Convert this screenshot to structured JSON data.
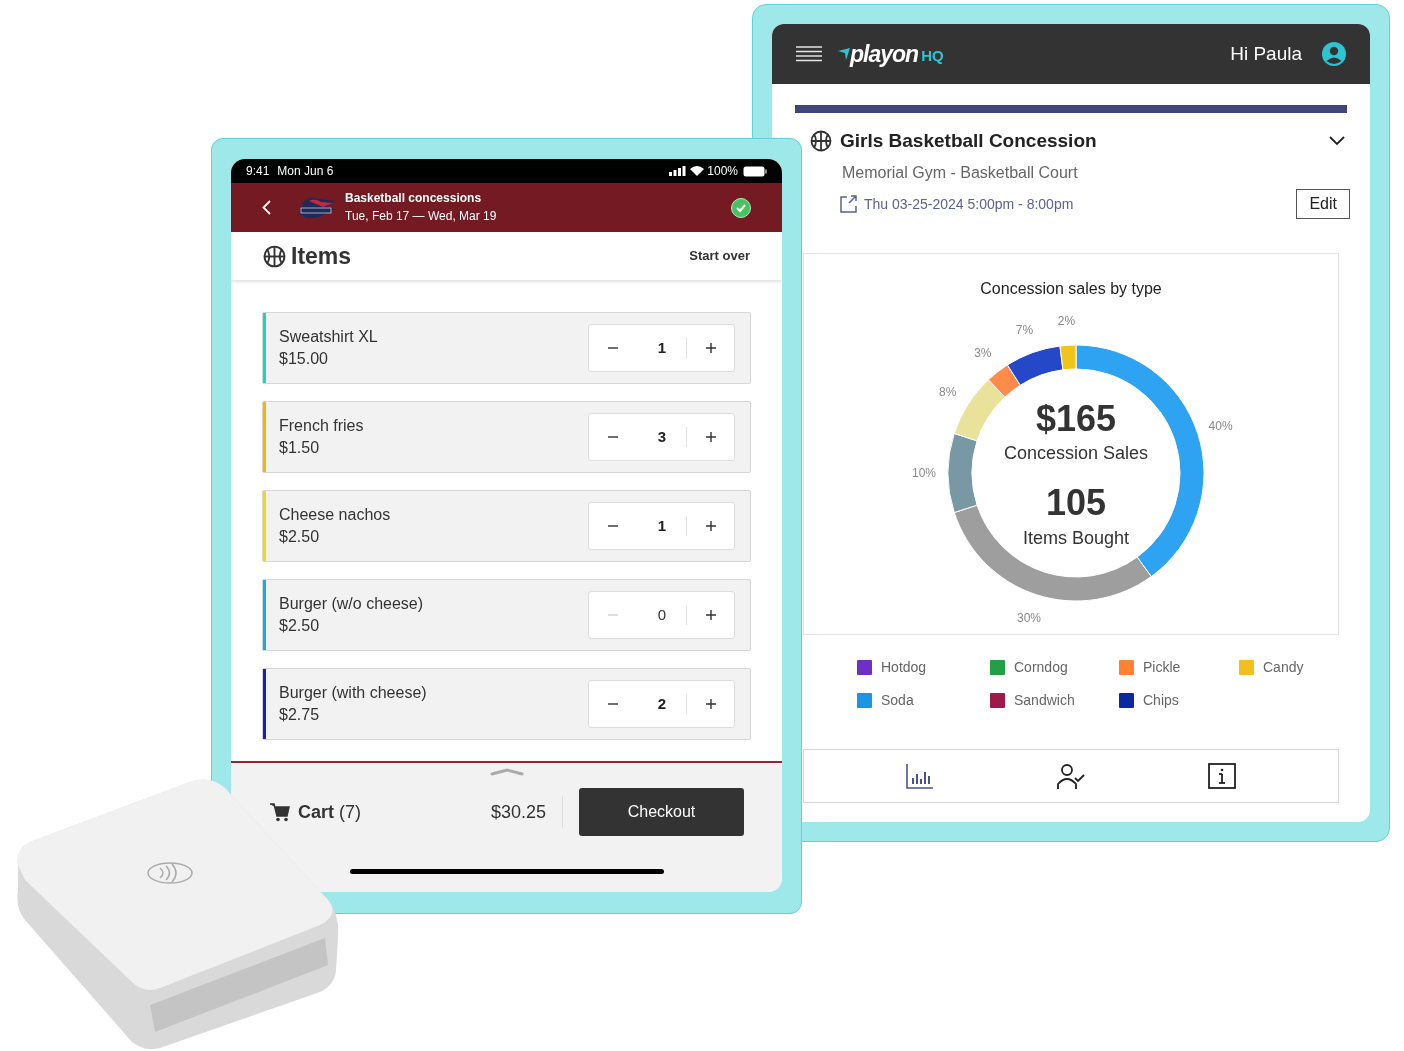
{
  "tablet": {
    "status_bar": {
      "time": "9:41",
      "date": "Mon Jun 6",
      "battery": "100%"
    },
    "header": {
      "title": "Basketball concessions",
      "dates": "Tue, Feb 17 — Wed, Mar 19"
    },
    "page_title": "Items",
    "start_over": "Start over",
    "items": [
      {
        "name": "Sweatshirt XL",
        "price": "$15.00",
        "quantity": "1",
        "color": "#1ed3c0",
        "minus_disabled": false
      },
      {
        "name": "French fries",
        "price": "$1.50",
        "quantity": "3",
        "color": "#f7b500",
        "minus_disabled": false
      },
      {
        "name": "Cheese nachos",
        "price": "$2.50",
        "quantity": "1",
        "color": "#f5d90a",
        "minus_disabled": false
      },
      {
        "name": "Burger (w/o cheese)",
        "price": "$2.50",
        "quantity": "0",
        "color": "#1ea7e8",
        "minus_disabled": true
      },
      {
        "name": "Burger (with cheese)",
        "price": "$2.75",
        "quantity": "2",
        "color": "#1a1fb8",
        "minus_disabled": false
      }
    ],
    "cart": {
      "label": "Cart",
      "count": "(7)",
      "total": "$30.25",
      "checkout": "Checkout"
    }
  },
  "dashboard": {
    "brand": "playon",
    "brand_suffix": "HQ",
    "greeting": "Hi Paula",
    "event": {
      "title": "Girls Basketball Concession",
      "location": "Memorial Gym - Basketball Court",
      "datetime": "Thu 03-25-2024 5:00pm - 8:00pm",
      "edit": "Edit"
    },
    "chart_title": "Concession sales by type",
    "chart_data": {
      "type": "donut",
      "values": [
        40,
        30,
        10,
        8,
        3,
        7,
        2
      ],
      "colors": [
        "#2ea3f2",
        "#9e9e9e",
        "#7898a3",
        "#e8e29a",
        "#ff8a4a",
        "#2448c8",
        "#f0c419"
      ],
      "data_labels": true,
      "value_labels": [
        "40%",
        "30%",
        "10%",
        "8%",
        "3%",
        "7%",
        "2%"
      ]
    },
    "center": {
      "amount": "$165",
      "amount_label": "Concession Sales",
      "count": "105",
      "count_label": "Items Bought"
    },
    "legend": [
      {
        "label": "Hotdog",
        "color": "#6e2fc8"
      },
      {
        "label": "Corndog",
        "color": "#23a047"
      },
      {
        "label": "Pickle",
        "color": "#ff8233"
      },
      {
        "label": "Candy",
        "color": "#f2c01e"
      },
      {
        "label": "Soda",
        "color": "#1a95e8"
      },
      {
        "label": "Sandwich",
        "color": "#9c1a4c"
      },
      {
        "label": "Chips",
        "color": "#0b2aa0"
      }
    ],
    "nav": [
      {
        "kind": "chart",
        "selected": true
      },
      {
        "kind": "person",
        "selected": false
      },
      {
        "kind": "info",
        "selected": false
      }
    ]
  }
}
